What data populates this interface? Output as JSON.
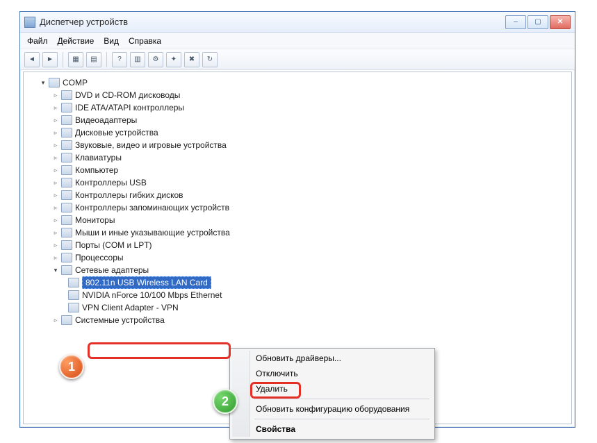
{
  "window": {
    "title": "Диспетчер устройств",
    "buttons": {
      "minimize": "–",
      "maximize": "▢",
      "close": "✕"
    }
  },
  "menu": {
    "file": "Файл",
    "action": "Действие",
    "view": "Вид",
    "help": "Справка"
  },
  "toolbar": {
    "back": "◄",
    "forward": "►",
    "b1": "▦",
    "b2": "▤",
    "b3": "?",
    "b4": "▥",
    "b5": "⚙",
    "b6": "✦",
    "b7": "✖",
    "b8": "↻"
  },
  "tree": {
    "root": "COMP",
    "items": [
      {
        "label": "DVD и CD-ROM дисководы"
      },
      {
        "label": "IDE ATA/ATAPI контроллеры"
      },
      {
        "label": "Видеоадаптеры"
      },
      {
        "label": "Дисковые устройства"
      },
      {
        "label": "Звуковые, видео и игровые устройства"
      },
      {
        "label": "Клавиатуры"
      },
      {
        "label": "Компьютер"
      },
      {
        "label": "Контроллеры USB"
      },
      {
        "label": "Контроллеры гибких дисков"
      },
      {
        "label": "Контроллеры запоминающих устройств"
      },
      {
        "label": "Мониторы"
      },
      {
        "label": "Мыши и иные указывающие устройства"
      },
      {
        "label": "Порты (COM и LPT)"
      },
      {
        "label": "Процессоры"
      }
    ],
    "network": {
      "label": "Сетевые адаптеры",
      "children": [
        {
          "label": "802.11n USB Wireless LAN Card",
          "selected": true
        },
        {
          "label": "NVIDIA nForce 10/100 Mbps Ethernet"
        },
        {
          "label": "VPN Client Adapter - VPN"
        }
      ]
    },
    "system_devices": "Системные устройства"
  },
  "context_menu": {
    "update": "Обновить драйверы...",
    "disable": "Отключить",
    "delete": "Удалить",
    "rescan": "Обновить конфигурацию оборудования",
    "properties": "Свойства"
  },
  "annotations": {
    "badge1": "1",
    "badge2": "2"
  }
}
